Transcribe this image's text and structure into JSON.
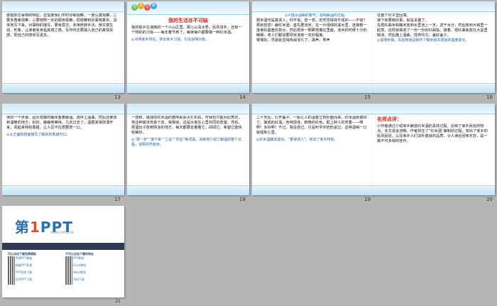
{
  "slides": [
    {
      "num": "13",
      "text": "要能抓住事物的特征，还需要我们平时仔细观察，一要认真观察，二要多角度观察，三要按照一定的顺序观察，把观察到的事物真实、具体地写下来。对事物的描写，要有层次，多用修辞手法，使文章生动、形象，让读者有身临其境之感。写作时还要融入自己的真情实感，把自己的感受写进去。"
    },
    {
      "num": "14",
      "tag_chars": [
        "范",
        "文",
        "引",
        "路"
      ],
      "title": "我的生活亦不可缺",
      "text": "我的故乡在滇南的一个小山区里，那儿山清水秀，民风淳朴，还有一个特别的习俗——每年春节到了，每家每户都要做一种红米酒。",
      "note": "◎点明家乡所在，突出家乡习俗，引出说明对象。"
    },
    {
      "num": "15",
      "note_top": "◎②描写酒曲的香气，说明酿酒的过程。",
      "text": "那米酒可是真诱人，你不信，尝一尝，定然觉得完不成的——不信？那就尝尝！酿红米酒，首先要泡米，在一片绿绿的溪水里，连接着一连串的晶莹的泉水，然后把米一颗颗地撒在里面，泡米的时候十分的精细，老人们都说要把米泡到一定的程度。",
      "footer": "慢慢的，早晨就显得热闹非凡了，歌声，笑声"
    },
    {
      "num": "16",
      "text": "在整个村子里回荡。\n接下来要做的事，就是关键了。\n先把红曲米和糯米放到水里泡上一天，滤干水分，然后放到大锅里一起蒸，这样就做成了一份一份的红曲饭。接着，把红曲饭放在大盆里晾凉，然后撒上酒曲，搅拌均匀，盖好盖子。",
      "note": "◎说明步骤，先动用道具制作了糯米饭并把饭的温度变化。"
    },
    {
      "num": "17",
      "text": "待的一个步骤，因为发酵的糯米香着酿酒，再拌上酒曲，然后还要放到温暖的地方，封好，静静地等待。几天过去了，酒香渐渐弥漫开来，闻起来特别香甜，让人忍不住想要尝一口。",
      "note": "◎从正面和侧面描写了糯米的香甜可口。"
    },
    {
      "num": "18",
      "text": "一揽和，做成的红米酒的香味就会大打折扣。可我也只能对此表示，将这种做法传承下去，我相信，这是大家在心里共同的愿望。然后，把酒坛子放到阴凉的地方，每天都要去看看它，闻闻它，希望它能快些酿好。",
      "note": "◎“那一步”“接下来”“之后”“然后”等词语，清晰地介绍了酿酒的整个过程，说明井然有序。"
    },
    {
      "num": "19",
      "text": "二十天后，打开盖子，一股沁人的酒香立刻扑面而来，红米酒就做好了。做成的红酒，色味俱佳，鲜艳的红色，配上醉人的芳香——啊啊！多好啊！不过，我没尝过，只是听爷爷奶奶说过，这种酒喝一口就甜到心里。",
      "note": "◎红米酒酿造成功，“香得诱人”，突出了家乡特色。"
    },
    {
      "num": "20",
      "title": "名师点评：",
      "text": "小作者通过介绍家乡酿造红米酒的具体过程，反映了家乡民俗的特点。本文语言流畅，作者抓住了“红米酒”酿制的过程，突出了家乡的民风民俗，以及家乡人们淳朴善良的品质，令人读后回味无穷，是一篇不可多得的佳作。"
    },
    {
      "num": "21"
    }
  ],
  "logo": {
    "brand": "第",
    "one": "1",
    "ppt": "PPT",
    "sub": "WWW.1PPT.COM"
  },
  "ppt_cols": [
    {
      "head": "可以点击下载免费模板",
      "lines": [
        "免费PPT模板",
        "精美PPT背景",
        "PPT图表下载",
        "优秀PPT下载"
      ]
    },
    {
      "head": "不可以点击下载的地址",
      "lines": [
        "PPT教程",
        "Excel教程",
        "Word教程",
        "资料下载"
      ]
    }
  ],
  "colors": {
    "accent": "#d32222",
    "note": "#1f5fa8",
    "bg": "#b5b5b5"
  }
}
